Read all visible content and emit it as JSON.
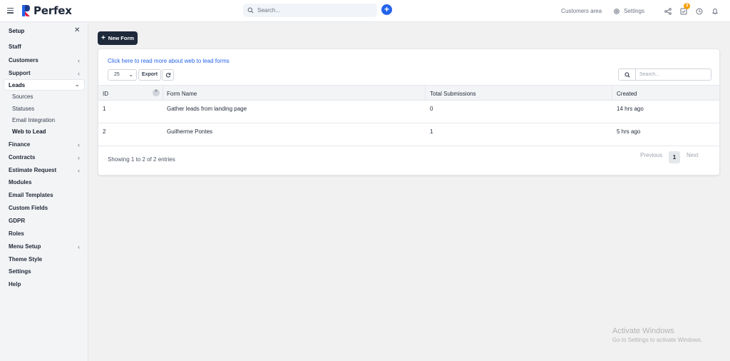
{
  "topbar": {
    "brand": "Perfex",
    "search_placeholder": "Search...",
    "customers_area": "Customers area",
    "settings": "Settings",
    "notification_count": "3",
    "accent_color": "#2563eb"
  },
  "sidebar": {
    "title": "Setup",
    "items": [
      {
        "label": "Staff",
        "chevron": false
      },
      {
        "label": "Customers",
        "chevron": true
      },
      {
        "label": "Support",
        "chevron": true
      }
    ],
    "active": {
      "label": "Leads"
    },
    "sub_items": [
      "Sources",
      "Statuses",
      "Email Integration",
      "Web to Lead"
    ],
    "items_after": [
      {
        "label": "Finance",
        "chevron": true
      },
      {
        "label": "Contracts",
        "chevron": true
      },
      {
        "label": "Estimate Request",
        "chevron": true
      },
      {
        "label": "Modules",
        "chevron": false
      },
      {
        "label": "Email Templates",
        "chevron": false
      },
      {
        "label": "Custom Fields",
        "chevron": false
      },
      {
        "label": "GDPR",
        "chevron": false
      },
      {
        "label": "Roles",
        "chevron": false
      },
      {
        "label": "Menu Setup",
        "chevron": true
      },
      {
        "label": "Theme Style",
        "chevron": false
      },
      {
        "label": "Settings",
        "chevron": false
      },
      {
        "label": "Help",
        "chevron": false
      }
    ]
  },
  "main": {
    "new_form_label": "New Form",
    "info_link": "Click here to read more about web to lead forms",
    "page_length": "25",
    "export_label": "Export",
    "search_placeholder": "Search...",
    "columns": [
      "ID",
      "Form Name",
      "Total Submissions",
      "Created"
    ],
    "rows": [
      {
        "id": "1",
        "name": "Gather leads from landing page",
        "submissions": "0",
        "created": "14 hrs ago"
      },
      {
        "id": "2",
        "name": "Guilherme Pontes",
        "submissions": "1",
        "created": "5 hrs ago"
      }
    ],
    "info_text": "Showing 1 to 2 of 2 entries",
    "pager": {
      "previous": "Previous",
      "current": "1",
      "next": "Next"
    }
  },
  "watermark": {
    "line1": "Activate Windows",
    "line2": "Go to Settings to activate Windows."
  }
}
